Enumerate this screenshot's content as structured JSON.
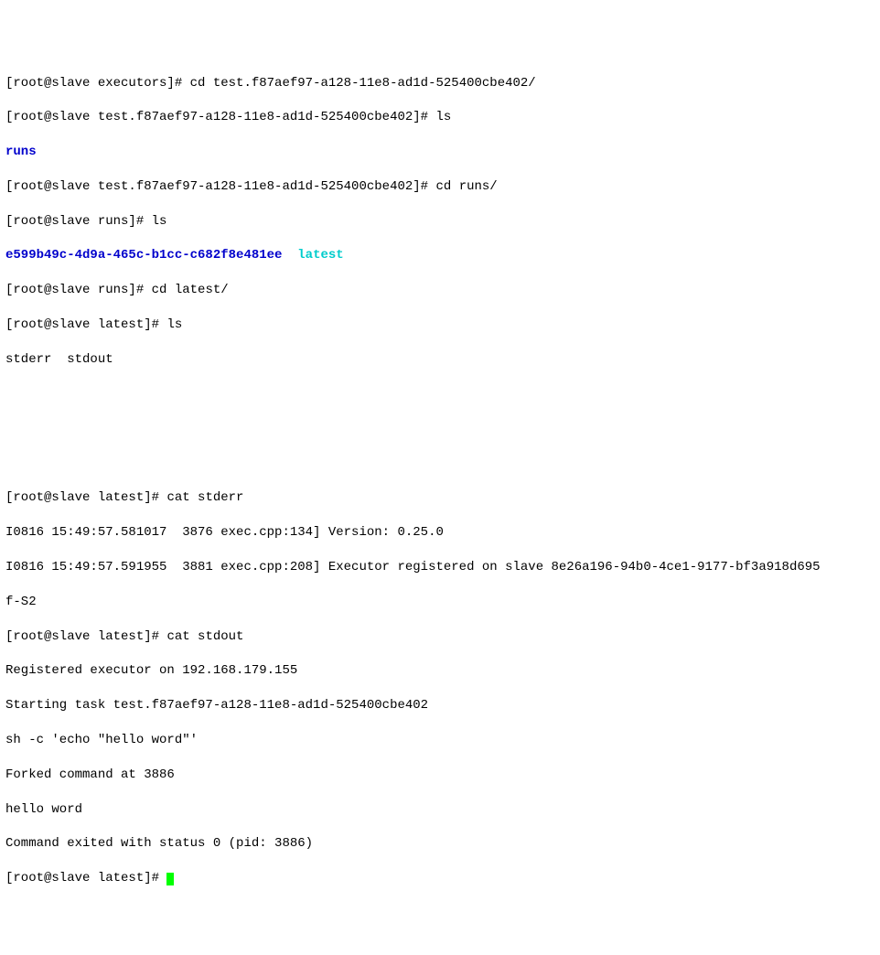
{
  "prompts": {
    "executors": "[root@slave executors]# ",
    "testdir": "[root@slave test.f87aef97-a128-11e8-ad1d-525400cbe402]# ",
    "runs": "[root@slave runs]# ",
    "latest": "[root@slave latest]# "
  },
  "cmds": {
    "cd_test": "cd test.f87aef97-a128-11e8-ad1d-525400cbe402/",
    "ls": "ls",
    "cd_runs": "cd runs/",
    "cd_latest": "cd latest/",
    "cat_stderr": "cat stderr",
    "cat_stdout": "cat stdout"
  },
  "listings": {
    "runs_dir": "runs",
    "run_uuid": "e599b49c-4d9a-465c-b1cc-c682f8e481ee",
    "latest_link": "latest",
    "stderr_stdout": "stderr  stdout"
  },
  "stderr": {
    "l1": "I0816 15:49:57.581017  3876 exec.cpp:134] Version: 0.25.0",
    "l2": "I0816 15:49:57.591955  3881 exec.cpp:208] Executor registered on slave 8e26a196-94b0-4ce1-9177-bf3a918d695",
    "l3": "f-S2"
  },
  "stdout": {
    "l1": "Registered executor on 192.168.179.155",
    "l2": "Starting task test.f87aef97-a128-11e8-ad1d-525400cbe402",
    "l3": "sh -c 'echo \"hello word\"'",
    "l4": "Forked command at 3886",
    "l5": "hello word",
    "l6": "Command exited with status 0 (pid: 3886)"
  }
}
